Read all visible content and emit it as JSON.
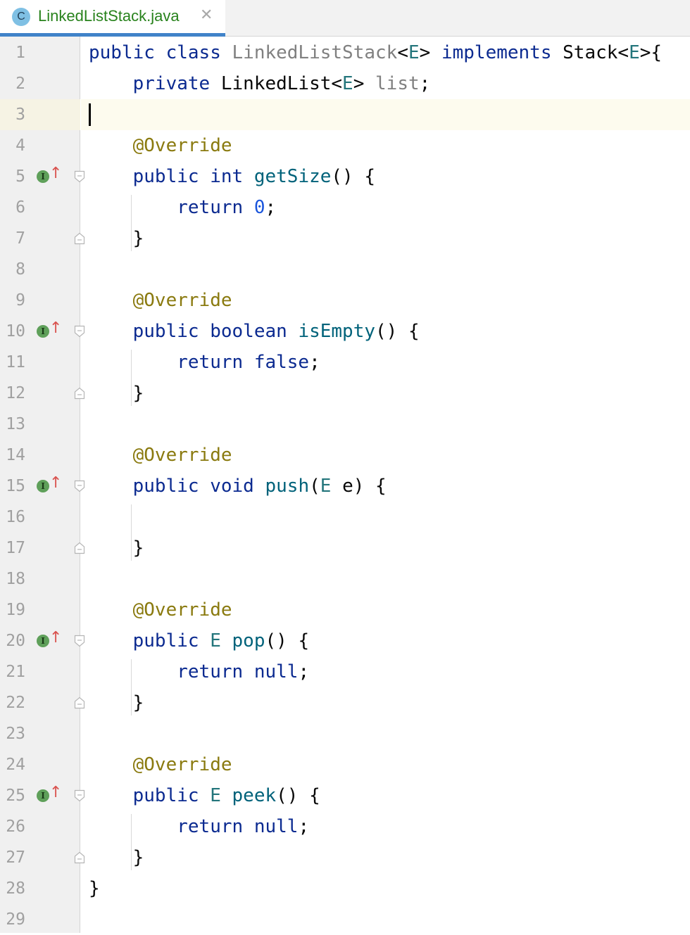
{
  "tab": {
    "icon_letter": "C",
    "file_name": "LinkedListStack.java",
    "close_glyph": "✕"
  },
  "colors": {
    "keyword": "#0b2a90",
    "type_param": "#23757b",
    "annotation": "#8a7a0f",
    "number": "#1a55dc",
    "method": "#00627a",
    "unused_field": "#808080",
    "current_line": "#fdfbee",
    "tab_active_underline": "#4083c9"
  },
  "editor": {
    "current_line": 3,
    "lines": [
      {
        "n": "1",
        "tokens": [
          {
            "t": "public",
            "c": "kw"
          },
          {
            "t": " ",
            "c": "pl"
          },
          {
            "t": "class",
            "c": "kw"
          },
          {
            "t": " ",
            "c": "pl"
          },
          {
            "t": "LinkedListStack",
            "c": "gr"
          },
          {
            "t": "<",
            "c": "pl"
          },
          {
            "t": "E",
            "c": "ty"
          },
          {
            "t": "> ",
            "c": "pl"
          },
          {
            "t": "implements",
            "c": "kw"
          },
          {
            "t": " Stack<",
            "c": "pl"
          },
          {
            "t": "E",
            "c": "ty"
          },
          {
            "t": ">{",
            "c": "pl"
          }
        ]
      },
      {
        "n": "2",
        "tokens": [
          {
            "t": "    ",
            "c": "pl"
          },
          {
            "t": "private",
            "c": "kw"
          },
          {
            "t": " LinkedList<",
            "c": "pl"
          },
          {
            "t": "E",
            "c": "ty"
          },
          {
            "t": "> ",
            "c": "pl"
          },
          {
            "t": "list",
            "c": "gr"
          },
          {
            "t": ";",
            "c": "pl"
          }
        ]
      },
      {
        "n": "3",
        "tokens": []
      },
      {
        "n": "4",
        "tokens": [
          {
            "t": "    ",
            "c": "pl"
          },
          {
            "t": "@Override",
            "c": "an"
          }
        ]
      },
      {
        "n": "5",
        "tokens": [
          {
            "t": "    ",
            "c": "pl"
          },
          {
            "t": "public",
            "c": "kw"
          },
          {
            "t": " ",
            "c": "pl"
          },
          {
            "t": "int",
            "c": "kw"
          },
          {
            "t": " ",
            "c": "pl"
          },
          {
            "t": "getSize",
            "c": "md"
          },
          {
            "t": "() {",
            "c": "pl"
          }
        ],
        "impl": true
      },
      {
        "n": "6",
        "tokens": [
          {
            "t": "        ",
            "c": "pl"
          },
          {
            "t": "return",
            "c": "kw"
          },
          {
            "t": " ",
            "c": "pl"
          },
          {
            "t": "0",
            "c": "nm"
          },
          {
            "t": ";",
            "c": "pl"
          }
        ]
      },
      {
        "n": "7",
        "tokens": [
          {
            "t": "    }",
            "c": "pl"
          }
        ]
      },
      {
        "n": "8",
        "tokens": []
      },
      {
        "n": "9",
        "tokens": [
          {
            "t": "    ",
            "c": "pl"
          },
          {
            "t": "@Override",
            "c": "an"
          }
        ]
      },
      {
        "n": "10",
        "tokens": [
          {
            "t": "    ",
            "c": "pl"
          },
          {
            "t": "public",
            "c": "kw"
          },
          {
            "t": " ",
            "c": "pl"
          },
          {
            "t": "boolean",
            "c": "kw"
          },
          {
            "t": " ",
            "c": "pl"
          },
          {
            "t": "isEmpty",
            "c": "md"
          },
          {
            "t": "() {",
            "c": "pl"
          }
        ],
        "impl": true
      },
      {
        "n": "11",
        "tokens": [
          {
            "t": "        ",
            "c": "pl"
          },
          {
            "t": "return",
            "c": "kw"
          },
          {
            "t": " ",
            "c": "pl"
          },
          {
            "t": "false",
            "c": "kw"
          },
          {
            "t": ";",
            "c": "pl"
          }
        ]
      },
      {
        "n": "12",
        "tokens": [
          {
            "t": "    }",
            "c": "pl"
          }
        ]
      },
      {
        "n": "13",
        "tokens": []
      },
      {
        "n": "14",
        "tokens": [
          {
            "t": "    ",
            "c": "pl"
          },
          {
            "t": "@Override",
            "c": "an"
          }
        ]
      },
      {
        "n": "15",
        "tokens": [
          {
            "t": "    ",
            "c": "pl"
          },
          {
            "t": "public",
            "c": "kw"
          },
          {
            "t": " ",
            "c": "pl"
          },
          {
            "t": "void",
            "c": "kw"
          },
          {
            "t": " ",
            "c": "pl"
          },
          {
            "t": "push",
            "c": "md"
          },
          {
            "t": "(",
            "c": "pl"
          },
          {
            "t": "E",
            "c": "ty"
          },
          {
            "t": " e) {",
            "c": "pl"
          }
        ],
        "impl": true
      },
      {
        "n": "16",
        "tokens": []
      },
      {
        "n": "17",
        "tokens": [
          {
            "t": "    }",
            "c": "pl"
          }
        ]
      },
      {
        "n": "18",
        "tokens": []
      },
      {
        "n": "19",
        "tokens": [
          {
            "t": "    ",
            "c": "pl"
          },
          {
            "t": "@Override",
            "c": "an"
          }
        ]
      },
      {
        "n": "20",
        "tokens": [
          {
            "t": "    ",
            "c": "pl"
          },
          {
            "t": "public",
            "c": "kw"
          },
          {
            "t": " ",
            "c": "pl"
          },
          {
            "t": "E",
            "c": "ty"
          },
          {
            "t": " ",
            "c": "pl"
          },
          {
            "t": "pop",
            "c": "md"
          },
          {
            "t": "() {",
            "c": "pl"
          }
        ],
        "impl": true
      },
      {
        "n": "21",
        "tokens": [
          {
            "t": "        ",
            "c": "pl"
          },
          {
            "t": "return",
            "c": "kw"
          },
          {
            "t": " ",
            "c": "pl"
          },
          {
            "t": "null",
            "c": "kw"
          },
          {
            "t": ";",
            "c": "pl"
          }
        ]
      },
      {
        "n": "22",
        "tokens": [
          {
            "t": "    }",
            "c": "pl"
          }
        ]
      },
      {
        "n": "23",
        "tokens": []
      },
      {
        "n": "24",
        "tokens": [
          {
            "t": "    ",
            "c": "pl"
          },
          {
            "t": "@Override",
            "c": "an"
          }
        ]
      },
      {
        "n": "25",
        "tokens": [
          {
            "t": "    ",
            "c": "pl"
          },
          {
            "t": "public",
            "c": "kw"
          },
          {
            "t": " ",
            "c": "pl"
          },
          {
            "t": "E",
            "c": "ty"
          },
          {
            "t": " ",
            "c": "pl"
          },
          {
            "t": "peek",
            "c": "md"
          },
          {
            "t": "() {",
            "c": "pl"
          }
        ],
        "impl": true
      },
      {
        "n": "26",
        "tokens": [
          {
            "t": "        ",
            "c": "pl"
          },
          {
            "t": "return",
            "c": "kw"
          },
          {
            "t": " ",
            "c": "pl"
          },
          {
            "t": "null",
            "c": "kw"
          },
          {
            "t": ";",
            "c": "pl"
          }
        ]
      },
      {
        "n": "27",
        "tokens": [
          {
            "t": "    }",
            "c": "pl"
          }
        ]
      },
      {
        "n": "28",
        "tokens": [
          {
            "t": "}",
            "c": "pl"
          }
        ]
      },
      {
        "n": "29",
        "tokens": []
      }
    ],
    "gutter_icons": {
      "implements_badge": "I",
      "implements_arrow": "↑"
    }
  }
}
